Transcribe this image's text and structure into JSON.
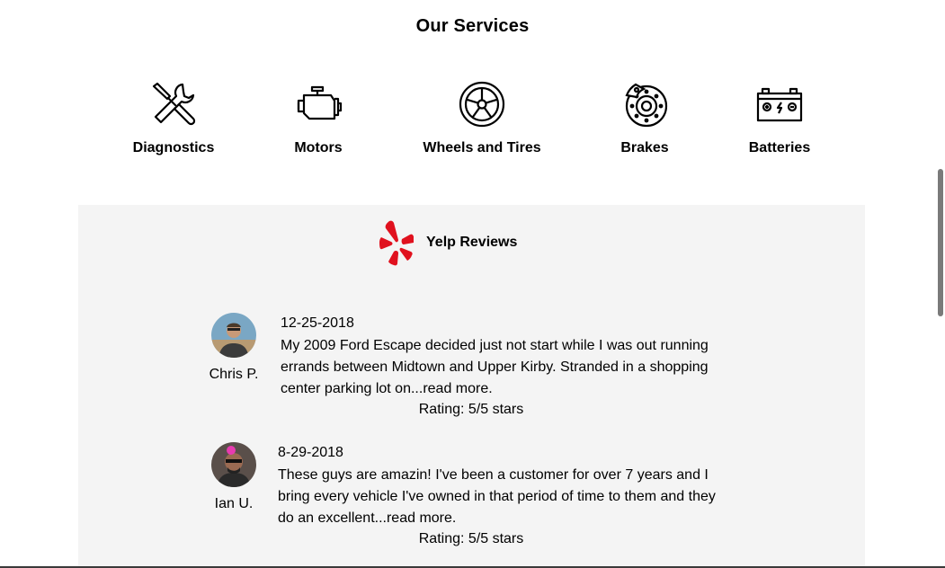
{
  "services": {
    "title": "Our Services",
    "items": [
      {
        "label": "Diagnostics",
        "icon": "wrench-screwdriver-icon"
      },
      {
        "label": "Motors",
        "icon": "engine-icon"
      },
      {
        "label": "Wheels and Tires",
        "icon": "wheel-icon"
      },
      {
        "label": "Brakes",
        "icon": "brake-disc-icon"
      },
      {
        "label": "Batteries",
        "icon": "battery-icon"
      }
    ]
  },
  "reviews": {
    "title": "Yelp Reviews",
    "logo": "yelp-logo-icon",
    "accent_color": "#e0111e",
    "items": [
      {
        "name": "Chris P.",
        "date": "12-25-2018",
        "text": "My 2009 Ford Escape decided just not start while I was out running errands between Midtown and Upper Kirby. Stranded in a shopping center parking lot on...read more.",
        "rating": "Rating: 5/5 stars"
      },
      {
        "name": "Ian U.",
        "date": "8-29-2018",
        "text": "These guys are amazin! I've been a customer for over 7 years and I bring every vehicle I've owned in that period of time to them and they do an excellent...read more.",
        "rating": "Rating: 5/5 stars"
      }
    ]
  }
}
